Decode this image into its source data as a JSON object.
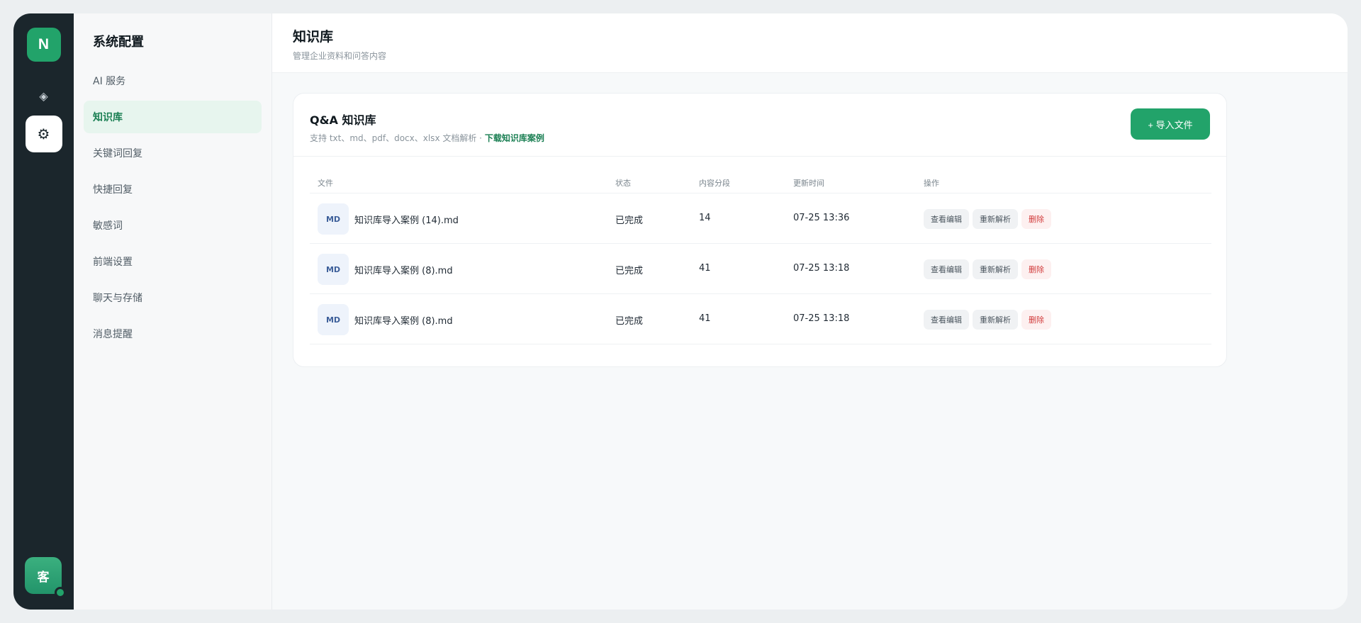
{
  "rail": {
    "logo": "N",
    "icon1": "◈",
    "icon2": "⚙",
    "avatar": "客"
  },
  "sidenav": {
    "title": "系统配置",
    "items": [
      {
        "label": "AI 服务"
      },
      {
        "label": "知识库"
      },
      {
        "label": "关键词回复"
      },
      {
        "label": "快捷回复"
      },
      {
        "label": "敏感词"
      },
      {
        "label": "前端设置"
      },
      {
        "label": "聊天与存储"
      },
      {
        "label": "消息提醒"
      }
    ]
  },
  "header": {
    "title": "知识库",
    "subtitle": "管理企业资料和问答内容"
  },
  "card": {
    "title": "Q&A 知识库",
    "desc": "支持 txt、md、pdf、docx、xlsx 文档解析 · ",
    "link": "下载知识库案例",
    "import_label": "+ 导入文件"
  },
  "table": {
    "headers": {
      "file": "文件",
      "status": "状态",
      "segments": "内容分段",
      "updated": "更新时间",
      "actions": "操作"
    },
    "rows": [
      {
        "badge": "MD",
        "file": "知识库导入案例 (14).md",
        "status": "已完成",
        "segments": "14",
        "updated": "07-25 13:36"
      },
      {
        "badge": "MD",
        "file": "知识库导入案例 (8).md",
        "status": "已完成",
        "segments": "41",
        "updated": "07-25 13:18"
      },
      {
        "badge": "MD",
        "file": "知识库导入案例 (8).md",
        "status": "已完成",
        "segments": "41",
        "updated": "07-25 13:18"
      }
    ],
    "action_labels": {
      "view": "查看编辑",
      "reparse": "重新解析",
      "delete": "删除"
    }
  },
  "colors": {
    "accent": "#22a36a",
    "rail": "#1b262c",
    "danger": "#d23b3b"
  }
}
